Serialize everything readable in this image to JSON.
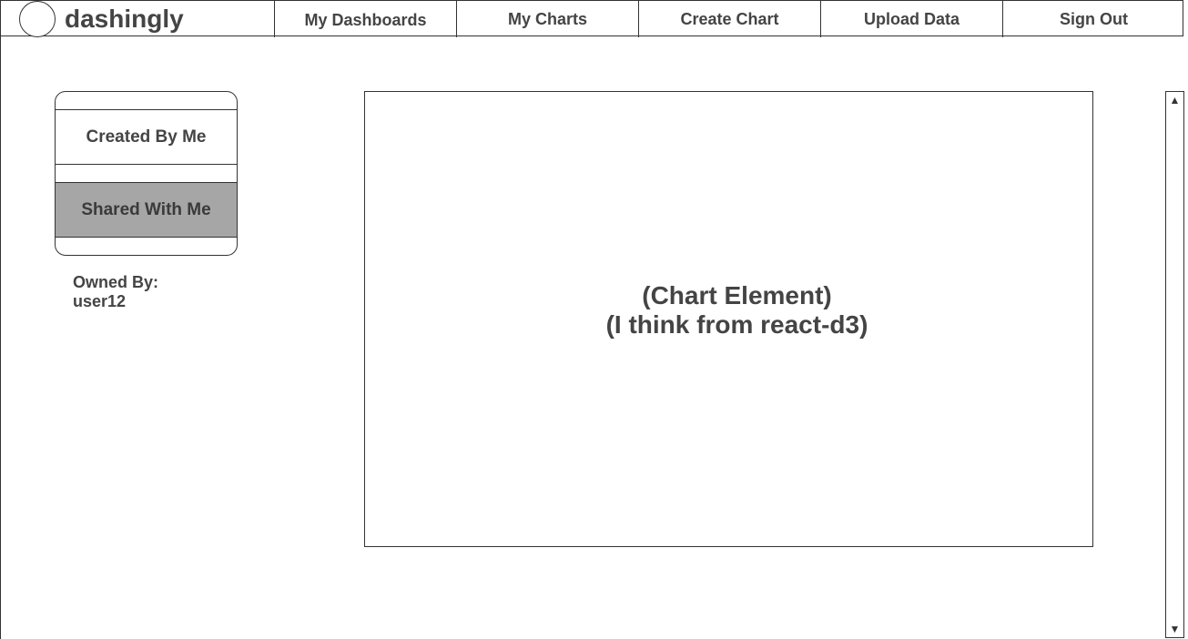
{
  "app": {
    "brand": "dashingly"
  },
  "nav": {
    "items": [
      {
        "label": "My Dashboards"
      },
      {
        "label": "My Charts"
      },
      {
        "label": "Create Chart"
      },
      {
        "label": "Upload Data"
      },
      {
        "label": "Sign Out"
      }
    ]
  },
  "filters": {
    "created_label": "Created By Me",
    "shared_label": "Shared With Me",
    "selected": "Shared With Me"
  },
  "owner": {
    "label": "Owned By:",
    "name": "user12"
  },
  "chart": {
    "line1": "(Chart Element)",
    "line2": "(I think from react-d3)"
  },
  "scrollbar": {
    "up_icon": "▲",
    "down_icon": "▼"
  },
  "colors": {
    "selected_bg": "#a6a6a6",
    "text": "#444444",
    "border": "#333333"
  }
}
